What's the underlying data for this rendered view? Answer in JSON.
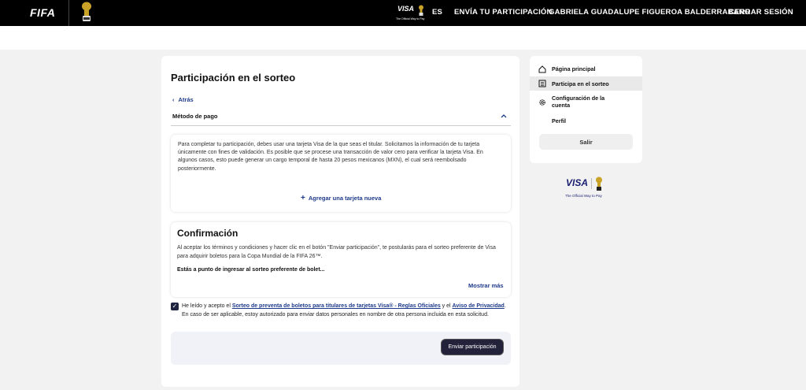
{
  "header": {
    "brand": "FIFA",
    "visa_word": "VISA",
    "visa_tag": "The Official Way to Pay",
    "nav": {
      "language": "ES",
      "submit_entry": "ENVÍA TU PARTICIPACIÓN",
      "user_name": "GABRIELA GUADALUPE FIGUEROA BALDERRABANO",
      "logout": "CERRAR SESIÓN"
    }
  },
  "main": {
    "title": "Participación en el sorteo",
    "back_label": "Atrás",
    "payment_section_label": "Método de pago",
    "payment_text": "Para completar tu participación, debes usar una tarjeta Visa de la que seas el titular. Solicitamos la información de tu tarjeta únicamente con fines de validación. Es posible que se procese una transacción de valor cero para verificar la tarjeta Visa. En algunos casos, esto puede generar un cargo temporal de hasta 20 pesos mexicanos (MXN), el cual será reembolsado posteriormente.",
    "add_card_label": "Agregar una tarjeta nueva",
    "confirmation": {
      "title": "Confirmación",
      "text": "Al aceptar los términos y condiciones y hacer clic en el botón \"Enviar participación\", te postularás para el sorteo preferente de Visa para adquirir boletos para la Copa Mundial de la FIFA 26™.",
      "bold_text": "Estás a punto de ingresar al sorteo preferente de bolet...",
      "show_more": "Mostrar más"
    },
    "consent": {
      "checked": true,
      "prefix": "He leído y acepto el ",
      "terms_link": "Sorteo de preventa de boletos para titulares de tarjetas Visa® - Reglas Oficiales",
      "middle": " y el ",
      "privacy_link": "Aviso de Privacidad",
      "suffix": ". En caso de ser aplicable, estoy autorizado para enviar datos personales en nombre de otra persona incluida en esta solicitud."
    },
    "submit_label": "Enviar participación"
  },
  "sidebar": {
    "items": [
      {
        "label": "Página principal",
        "icon": "home-icon",
        "active": false
      },
      {
        "label": "Participa en el sorteo",
        "icon": "list-icon",
        "active": true
      },
      {
        "label": "Configuración de la cuenta",
        "icon": "gear-icon",
        "active": false
      },
      {
        "label": "Perfil",
        "icon": "",
        "active": false
      }
    ],
    "logout_label": "Salir"
  },
  "footer_logo": {
    "visa_word": "VISA",
    "visa_tag": "The Official Way to Pay"
  },
  "colors": {
    "accent_link": "#1e3a8a",
    "topbar": "#000000",
    "button_dark": "#22223a",
    "visa_blue": "#1a1f71"
  }
}
